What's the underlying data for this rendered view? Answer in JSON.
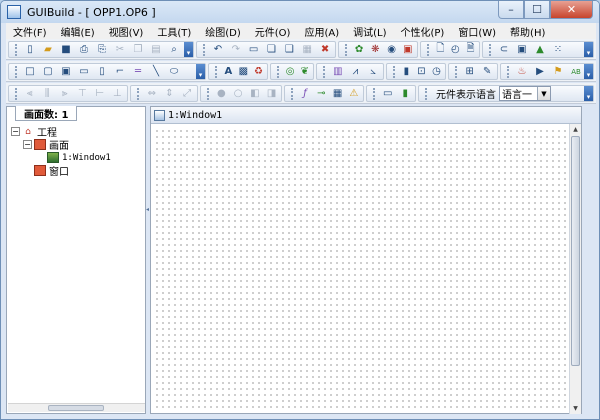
{
  "window": {
    "title": "GUIBuild - [ OPP1.OP6 ]",
    "controls": {
      "minimize": "–",
      "maximize": "☐",
      "close": "✕"
    }
  },
  "menu": [
    "文件(F)",
    "编辑(E)",
    "视图(V)",
    "工具(T)",
    "绘图(D)",
    "元件(O)",
    "应用(A)",
    "调试(L)",
    "个性化(P)",
    "窗口(W)",
    "帮助(H)"
  ],
  "toolbars": {
    "row1_icons": [
      "new-file",
      "open-folder",
      "save",
      "print",
      "print-preview",
      "cut",
      "copy",
      "paste",
      "find",
      "undo",
      "redo",
      "rectangle-obj",
      "group-1",
      "group-2",
      "group-3",
      "delete-red",
      "component-1",
      "component-2",
      "component-3",
      "component-4",
      "page-1",
      "page-2",
      "page-3",
      "link",
      "window-obj",
      "picture",
      "grid-dots"
    ],
    "row2_icons": [
      "rect-1",
      "rect-2",
      "rect-3",
      "rect-4",
      "rect-5",
      "corner",
      "ruler",
      "line",
      "ellipse",
      "text-a",
      "bitmap",
      "recycle",
      "gauge",
      "leaf",
      "chart-1",
      "chart-2",
      "chart-3",
      "slider",
      "meter",
      "clock",
      "param",
      "alarm",
      "play",
      "flag",
      "abc"
    ],
    "row3_icons": [
      "align-1",
      "align-2",
      "align-3",
      "align-4",
      "align-5",
      "align-6",
      "size-1",
      "size-2",
      "lock-1",
      "lock-2",
      "layer-1",
      "layer-2",
      "fx",
      "toggle",
      "table",
      "warning",
      "monitor",
      "indicator"
    ],
    "language_label": "元件表示语言",
    "language_value": "语言一"
  },
  "panel": {
    "tab_label": "画面数: 1",
    "tree": {
      "root": "工程",
      "screens_node": "画面",
      "screen_item": "1:Window1",
      "windows_node": "窗口"
    }
  },
  "document": {
    "title": "1:Window1"
  }
}
